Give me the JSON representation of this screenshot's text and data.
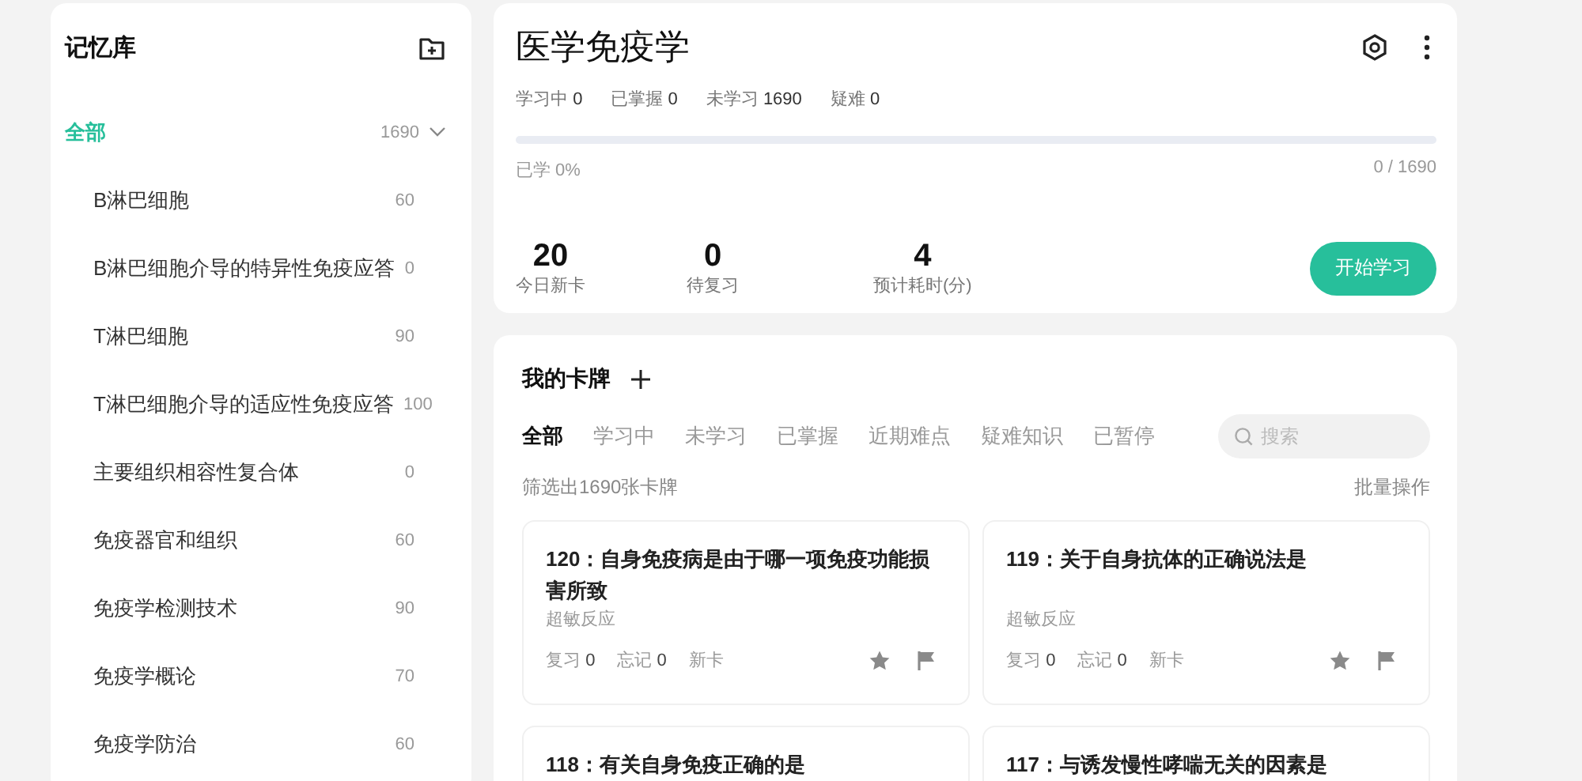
{
  "sidebar": {
    "title": "记忆库",
    "tree": [
      {
        "label": "全部",
        "count": "1690",
        "selected": true,
        "expanded": true,
        "children": [
          {
            "label": "B淋巴细胞",
            "count": "60",
            "selected": false
          },
          {
            "label": "B淋巴细胞介导的特异性免疫应答",
            "count": "0",
            "selected": false
          },
          {
            "label": "T淋巴细胞",
            "count": "90",
            "selected": false
          },
          {
            "label": "T淋巴细胞介导的适应性免疫应答",
            "count": "100",
            "selected": false
          },
          {
            "label": "主要组织相容性复合体",
            "count": "0",
            "selected": false
          },
          {
            "label": "免疫器官和组织",
            "count": "60",
            "selected": false
          },
          {
            "label": "免疫学检测技术",
            "count": "90",
            "selected": false
          },
          {
            "label": "免疫学概论",
            "count": "70",
            "selected": false
          },
          {
            "label": "免疫学防治",
            "count": "60",
            "selected": false
          }
        ]
      }
    ]
  },
  "deck": {
    "title": "医学免疫学",
    "stats": [
      {
        "label": "学习中",
        "value": "0"
      },
      {
        "label": "已掌握",
        "value": "0"
      },
      {
        "label": "未学习",
        "value": "1690"
      },
      {
        "label": "疑难",
        "value": "0"
      }
    ],
    "progress": {
      "level": 0,
      "label": "已学 0%",
      "reading": "0 / 1690"
    },
    "summary": [
      {
        "value": "20",
        "label": "今日新卡"
      },
      {
        "value": "0",
        "label": "待复习"
      },
      {
        "value": "4",
        "label": "预计耗时(分)"
      }
    ],
    "start_button": "开始学习"
  },
  "cards": {
    "title": "我的卡牌",
    "tabs": [
      {
        "label": "全部",
        "selected": true
      },
      {
        "label": "学习中",
        "selected": false
      },
      {
        "label": "未学习",
        "selected": false
      },
      {
        "label": "已掌握",
        "selected": false
      },
      {
        "label": "近期难点",
        "selected": false
      },
      {
        "label": "疑难知识",
        "selected": false
      },
      {
        "label": "已暂停",
        "selected": false
      }
    ],
    "search": {
      "placeholder": "搜索"
    },
    "filter_text": "筛选出1690张卡牌",
    "batch_action": "批量操作",
    "items": [
      {
        "title": "120：自身免疫病是由于哪一项免疫功能损害所致",
        "tag": "超敏反应",
        "stats": [
          {
            "label": "复习",
            "value": "0"
          },
          {
            "label": "忘记",
            "value": "0"
          }
        ],
        "status": "新卡"
      },
      {
        "title": "119：关于自身抗体的正确说法是",
        "tag": "超敏反应",
        "stats": [
          {
            "label": "复习",
            "value": "0"
          },
          {
            "label": "忘记",
            "value": "0"
          }
        ],
        "status": "新卡"
      },
      {
        "title": "118：有关自身免疫正确的是"
      },
      {
        "title": "117：与诱发慢性哮喘无关的因素是"
      }
    ]
  }
}
